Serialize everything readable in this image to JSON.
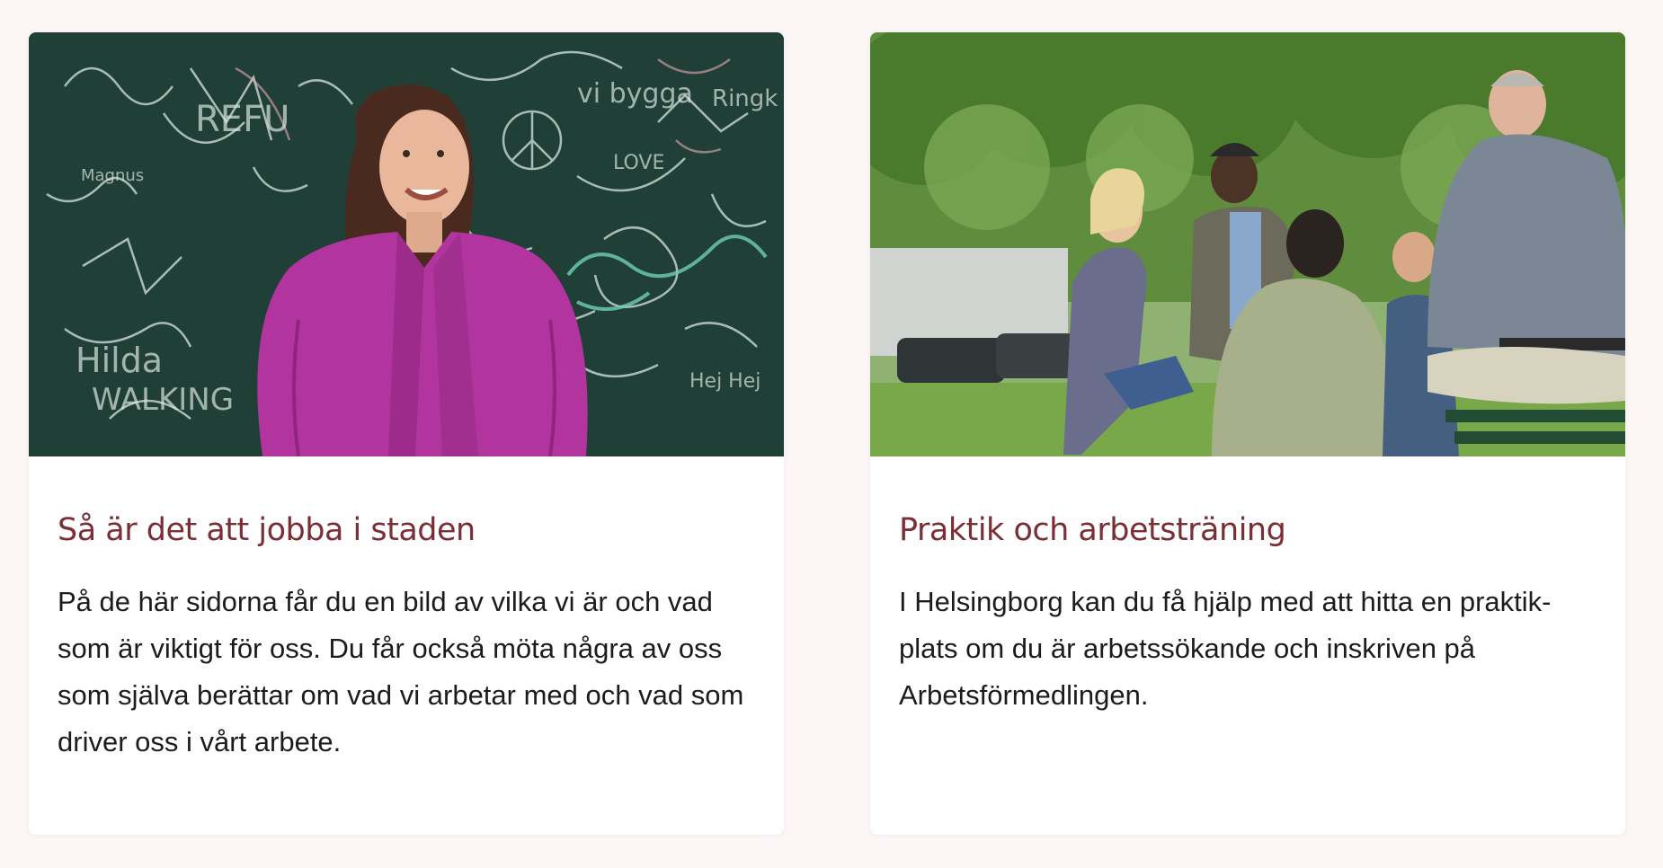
{
  "colors": {
    "page_background": "#fcf6f7",
    "card_background": "#ffffff",
    "title_color": "#7a2e35",
    "text_color": "#1c1c1c"
  },
  "cards": [
    {
      "title": "Så är det att jobba i staden",
      "text": "På de här sidorna får du en bild av vilka vi är och vad som är viktigt för oss. Du får också möta några av oss som själva berättar om vad vi arbetar med och vad som driver oss i vårt arbete.",
      "image": {
        "wall_writing": [
          "Hilda",
          "WALKING",
          "Magnus",
          "Hej Hej",
          "REFU",
          "vi bygga",
          "Ringk",
          "LOVE"
        ]
      }
    },
    {
      "title": "Praktik och arbetsträning",
      "text": "I Helsingborg kan du få hjälp med att hitta en praktik-plats om du är arbetssökande och inskriven på Arbetsförmedlingen."
    }
  ]
}
